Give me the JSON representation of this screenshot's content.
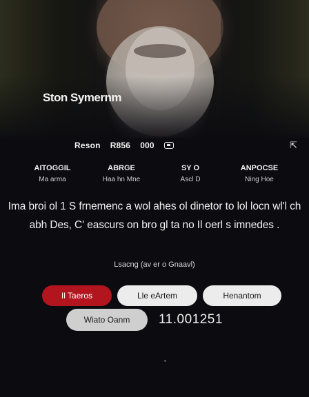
{
  "hero": {
    "title": "Ston Symernm"
  },
  "stats": {
    "item1": "Reson",
    "item2": "R856",
    "item3": "000"
  },
  "icons": {
    "stat_icon": "screen-icon",
    "share_icon": "share-icon"
  },
  "credits": [
    {
      "role": "AITOGGIL",
      "name": "Ma arma"
    },
    {
      "role": "ABRGE",
      "name": "Haa hn Mne"
    },
    {
      "role": "SY O",
      "name": "Ascl D"
    },
    {
      "role": "ANPOCSE",
      "name": "Ning Hoe"
    }
  ],
  "synopsis": "Ima broi ol 1 S frnemenc a wol ahes ol dinetor to lol locn wl'l ch abh Des, C' eascurs on bro gl ta no Il oerl s imnedes .",
  "meta_line": "Lsacng (av er o Gnaavl)",
  "buttons": {
    "primary": "Il Taeros",
    "secondary": "Lle eArtem",
    "tertiary": "Henantom",
    "quaternary": "Wiato Oanm"
  },
  "rating": "11.001251",
  "colors": {
    "accent": "#b3151f",
    "background": "#0b0b10"
  }
}
